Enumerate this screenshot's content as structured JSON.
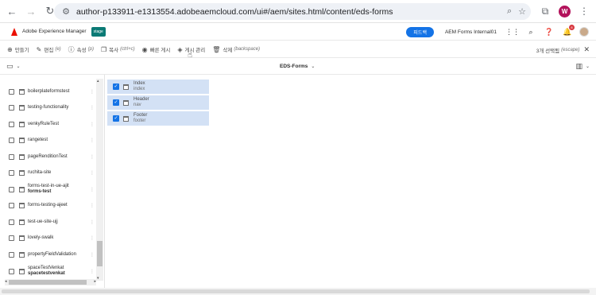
{
  "browser": {
    "back_icon": "arrow-left-icon",
    "forward_icon": "arrow-right-icon",
    "reload_icon": "reload-icon",
    "url": "author-p133911-e1313554.adobeaemcloud.com/ui#/aem/sites.html/content/eds-forms",
    "profile_initial": "W"
  },
  "header": {
    "app_name": "Adobe Experience Manager",
    "env_badge": "stage",
    "feedback_label": "피드백",
    "org_name": "AEM Forms Internal01",
    "notification_count": "8"
  },
  "actions": [
    {
      "icon": "⊕",
      "label": "만들기",
      "shortcut": ""
    },
    {
      "icon": "✎",
      "label": "편집",
      "shortcut": "(e)"
    },
    {
      "icon": "ⓘ",
      "label": "속성",
      "shortcut": "(p)"
    },
    {
      "icon": "❐",
      "label": "복사",
      "shortcut": "(ctrl+c)"
    },
    {
      "icon": "◉",
      "label": "빠른 게시",
      "shortcut": ""
    },
    {
      "icon": "◈",
      "label": "게시 관리",
      "shortcut": ""
    },
    {
      "icon": "🗑",
      "label": "삭제",
      "shortcut": "(backspace)"
    }
  ],
  "selection": {
    "label": "3개 선택됨",
    "shortcut": "(escape)"
  },
  "titlebar": {
    "title": "EDS-Forms"
  },
  "column1_items": [
    {
      "label": "boilerplateformstest",
      "sub": ""
    },
    {
      "label": "testing-functionality",
      "sub": ""
    },
    {
      "label": "venkyRuleTest",
      "sub": ""
    },
    {
      "label": "rangetest",
      "sub": ""
    },
    {
      "label": "pageRenditionTest",
      "sub": ""
    },
    {
      "label": "ruchita-site",
      "sub": ""
    },
    {
      "label": "forms-test-in-ue-ajit",
      "sub": "forms-test"
    },
    {
      "label": "forms-testing-ajeet",
      "sub": ""
    },
    {
      "label": "test-ue-site-ujj",
      "sub": ""
    },
    {
      "label": "lovely-swalk",
      "sub": ""
    },
    {
      "label": "propertyFieldValidation",
      "sub": ""
    },
    {
      "label": "spaceTestVenkat",
      "sub": "spacetestvenkat"
    }
  ],
  "column2_items": [
    {
      "title": "Index",
      "name": "index",
      "checked": true
    },
    {
      "title": "Header",
      "name": "nav",
      "checked": true
    },
    {
      "title": "Footer",
      "name": "footer",
      "checked": true
    }
  ],
  "colors": {
    "accent": "#1473e6",
    "selected_row": "#d3e1f5",
    "adobe_red": "#eb1000",
    "stage_badge": "#0b7a75"
  }
}
